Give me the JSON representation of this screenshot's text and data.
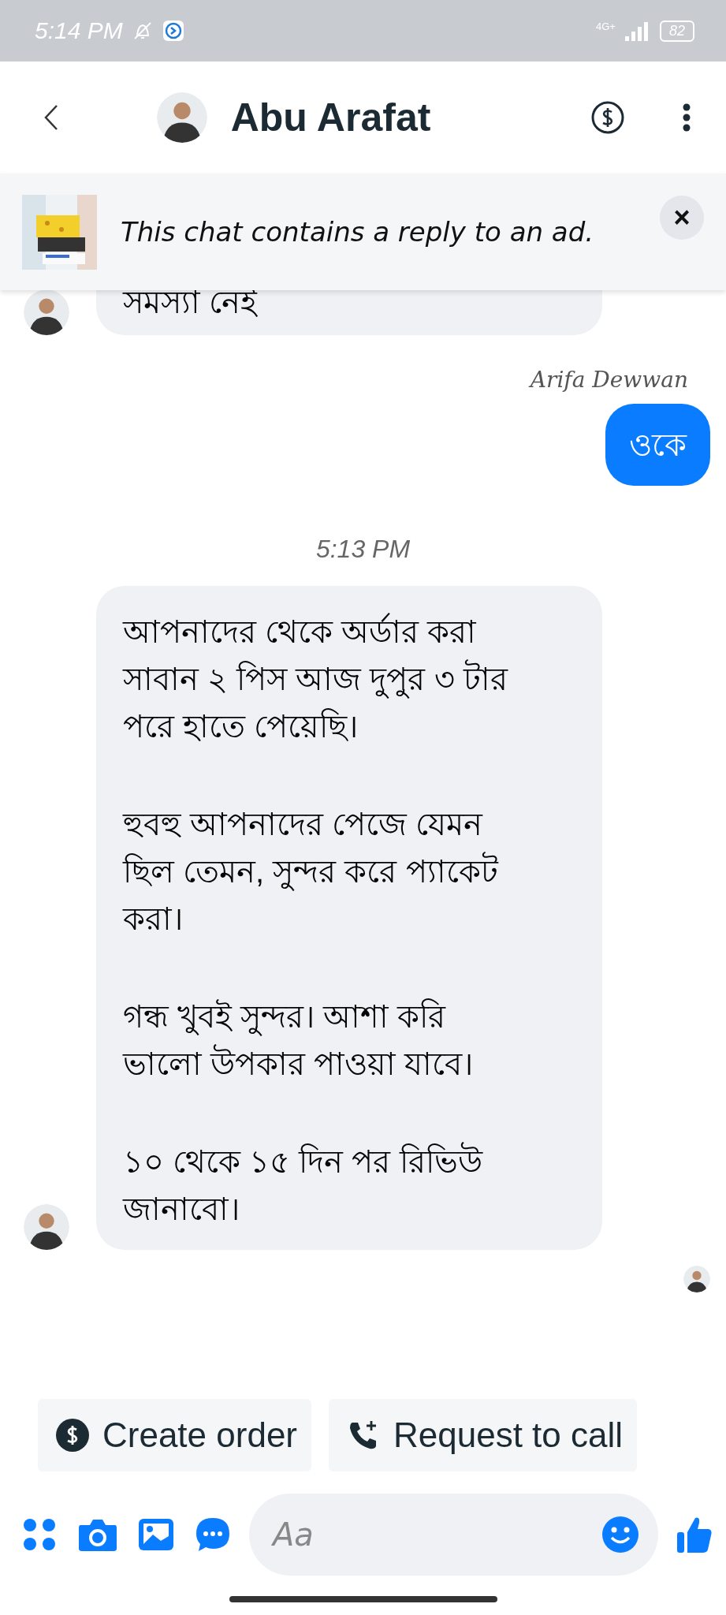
{
  "status_bar": {
    "time": "5:14 PM",
    "network": "4G+",
    "battery": "82"
  },
  "header": {
    "title": "Abu Arafat"
  },
  "ad_banner": {
    "text": "This chat contains a reply to an ad.",
    "close": "×"
  },
  "messages": [
    {
      "kind": "incoming",
      "avatar": true,
      "paragraphs": [
        "সমস্যা নেই"
      ]
    },
    {
      "kind": "sender",
      "text": "Arifa Dewwan"
    },
    {
      "kind": "outgoing",
      "paragraphs": [
        "ওকে"
      ]
    },
    {
      "kind": "timestamp",
      "text": "5:13 PM"
    },
    {
      "kind": "incoming",
      "avatar": true,
      "paragraphs": [
        "আপনাদের থেকে অর্ডার করা সাবান ২ পিস আজ দুপুর ৩ টার পরে হাতে পেয়েছি।",
        "হুবহু আপনাদের পেজে যেমন ছিল তেমন, সুন্দর করে প্যাকেট করা।",
        "গন্ধ খুবই সুন্দর। আশা করি ভালো উপকার পাওয়া যাবে।",
        "১০ থেকে ১৫ দিন পর রিভিউ জানাবো।"
      ]
    }
  ],
  "read_receipt": true,
  "quick_replies": [
    {
      "kind": "order",
      "label": "Create order"
    },
    {
      "kind": "call",
      "label": "Request to call"
    }
  ],
  "composer": {
    "placeholder": "Aa"
  }
}
